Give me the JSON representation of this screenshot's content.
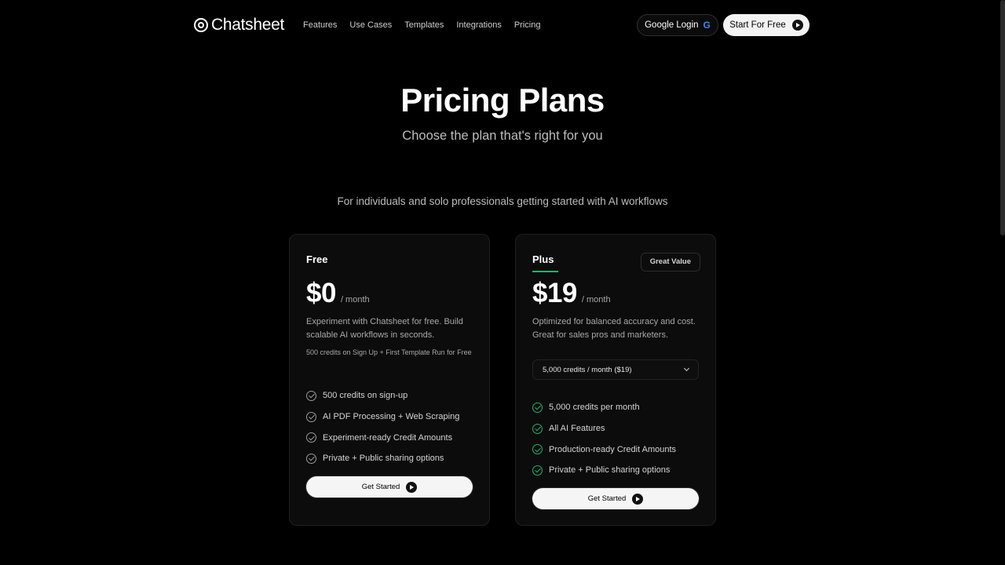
{
  "brand": {
    "name": "Chatsheet",
    "logo_icon": "concentric-circles-icon"
  },
  "nav": {
    "items": [
      {
        "label": "Features"
      },
      {
        "label": "Use Cases"
      },
      {
        "label": "Templates"
      },
      {
        "label": "Integrations"
      },
      {
        "label": "Pricing"
      }
    ],
    "google_login": "Google Login",
    "google_icon_glyph": "G",
    "start_free": "Start For Free"
  },
  "hero": {
    "title": "Pricing Plans",
    "subtitle": "Choose the plan that's right for you",
    "tagline": "For individuals and solo professionals getting started with AI workflows"
  },
  "plans": {
    "free": {
      "name": "Free",
      "price": "$0",
      "period": "/ month",
      "description": "Experiment with Chatsheet for free. Build scalable AI workflows in seconds.",
      "note": "500 credits on Sign Up + First Template Run for Free",
      "features": [
        "500 credits on sign-up",
        "AI PDF Processing + Web Scraping",
        "Experiment-ready Credit Amounts",
        "Private + Public sharing options"
      ],
      "cta": "Get Started"
    },
    "plus": {
      "name": "Plus",
      "badge": "Great Value",
      "price": "$19",
      "period": "/ month",
      "description": "Optimized for balanced accuracy and cost. Great for sales pros and marketers.",
      "selected_option": "5,000 credits / month ($19)",
      "features": [
        "5,000 credits per month",
        "All AI Features",
        "Production-ready Credit Amounts",
        "Private + Public sharing options"
      ],
      "cta": "Get Started"
    }
  },
  "colors": {
    "background": "#000000",
    "accent_green": "#1db56a",
    "card_bg": "#0c0c0c"
  }
}
